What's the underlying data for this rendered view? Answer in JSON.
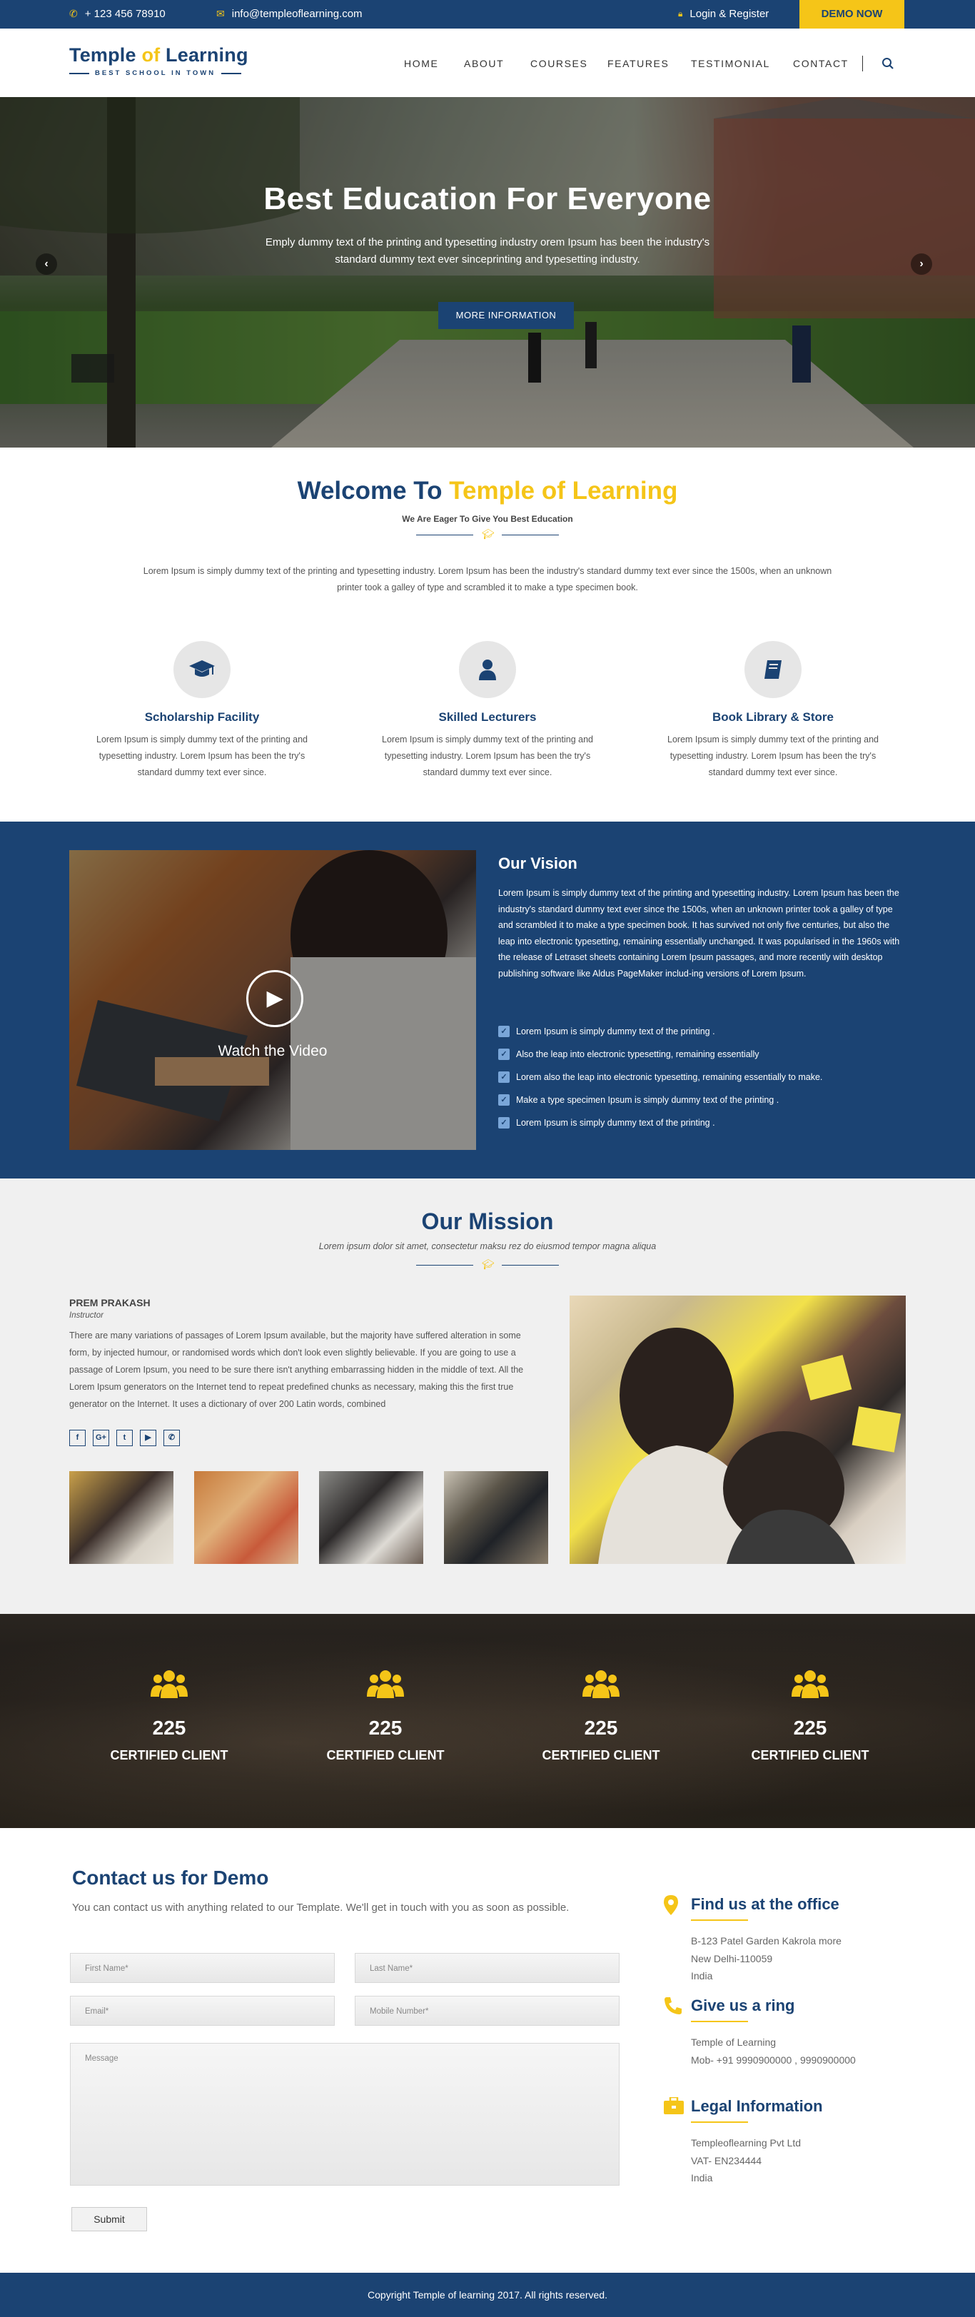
{
  "topbar": {
    "phone": "+ 123 456 78910",
    "email": "info@templeoflearning.com",
    "login": "Login & Register",
    "demo": "DEMO NOW"
  },
  "logo": {
    "pre": "Temple ",
    "of": "of",
    "post": " Learning",
    "tagline": "BEST SCHOOL IN TOWN"
  },
  "nav": [
    "HOME",
    "ABOUT",
    "COURSES",
    "FEATURES",
    "TESTIMONIAL",
    "CONTACT"
  ],
  "hero": {
    "title": "Best Education For Everyone",
    "text": "Emply dummy text of the printing and typesetting industry orem Ipsum has been the industry's standard dummy text ever sinceprinting and typesetting industry.",
    "button": "MORE INFORMATION",
    "prev": "‹",
    "next": "›"
  },
  "welcome": {
    "title_pre": "Welcome To ",
    "title_highlight": "Temple of Learning",
    "subtitle": "We Are Eager To Give You Best Education",
    "intro": "Lorem Ipsum is simply dummy text of the printing and typesetting industry. Lorem Ipsum has been the industry's standard dummy text ever since the 1500s, when an unknown printer took a galley of type and scrambled it to make a type specimen book."
  },
  "features": [
    {
      "icon": "graduation-cap-icon",
      "title": "Scholarship Facility",
      "text": "Lorem Ipsum is simply dummy text of the printing and typesetting industry. Lorem Ipsum has been the try's standard dummy text ever since."
    },
    {
      "icon": "user-icon",
      "title": "Skilled Lecturers",
      "text": "Lorem Ipsum is simply dummy text of the printing and typesetting industry. Lorem Ipsum has been the try's standard dummy text ever since."
    },
    {
      "icon": "book-icon",
      "title": "Book Library & Store",
      "text": "Lorem Ipsum is simply dummy text of the printing and typesetting industry. Lorem Ipsum has been the try's standard dummy text ever since."
    }
  ],
  "vision": {
    "video_label": "Watch the Video",
    "title": "Our Vision",
    "text": "Lorem Ipsum is simply dummy text of the printing and typesetting industry. Lorem Ipsum has been the industry's standard dummy text ever since the 1500s, when an unknown printer took a galley of type and scrambled it to make a type specimen book. It has survived not only five centuries, but also the leap into electronic typesetting, remaining essentially unchanged. It was popularised in the 1960s with the release of Letraset sheets containing Lorem Ipsum passages, and more recently with desktop publishing software like Aldus PageMaker includ-ing versions of Lorem Ipsum.",
    "checks": [
      "Lorem Ipsum is simply dummy text of the printing .",
      "Also the leap into electronic typesetting, remaining essentially",
      "Lorem also the leap into electronic typesetting, remaining essentially  to make.",
      "Make a type specimen Ipsum is simply dummy text of the printing .",
      "Lorem Ipsum is simply dummy text of the printing ."
    ]
  },
  "mission": {
    "title": "Our Mission",
    "tagline": "Lorem ipsum dolor sit amet, consectetur maksu rez do eiusmod tempor magna aliqua",
    "name": "PREM PRAKASH",
    "role": "Instructor",
    "text": "There are many variations of passages of Lorem Ipsum available, but the majority have suffered alteration in some form, by injected humour, or randomised words which don't look even slightly believable. If you are going to use a passage of Lorem Ipsum, you need to be sure there isn't anything embarrassing hidden in the middle of text. All the Lorem Ipsum generators on the Internet tend to repeat predefined chunks as necessary, making this the first true generator on the Internet. It uses a dictionary of over 200 Latin words, combined",
    "socials": [
      {
        "icon": "facebook-icon",
        "glyph": "f"
      },
      {
        "icon": "google-plus-icon",
        "glyph": "G+"
      },
      {
        "icon": "twitter-icon",
        "glyph": "t"
      },
      {
        "icon": "youtube-icon",
        "glyph": "▶"
      },
      {
        "icon": "whatsapp-icon",
        "glyph": "✆"
      }
    ]
  },
  "counters": [
    {
      "number": "225",
      "label": "CERTIFIED CLIENT"
    },
    {
      "number": "225",
      "label": "CERTIFIED CLIENT"
    },
    {
      "number": "225",
      "label": "CERTIFIED CLIENT"
    },
    {
      "number": "225",
      "label": "CERTIFIED CLIENT"
    }
  ],
  "contact": {
    "title": "Contact us for Demo",
    "text": "You can contact us with anything related to our Template. We'll get in touch with you as soon as possible.",
    "first_name": "First Name*",
    "last_name": "Last Name*",
    "email": "Email*",
    "mobile": "Mobile Number*",
    "message": "Message",
    "submit": "Submit"
  },
  "office": {
    "title": "Find us at the office",
    "lines": [
      "B-123 Patel Garden Kakrola more",
      "New Delhi-110059",
      "India"
    ]
  },
  "ring": {
    "title": "Give us a ring",
    "lines": [
      "Temple of Learning",
      "Mob- +91 9990900000 , 9990900000"
    ]
  },
  "legal": {
    "title": "Legal Information",
    "lines": [
      "Templeoflearning Pvt Ltd",
      "VAT- EN234444",
      "India"
    ]
  },
  "footer": {
    "copyright": "Copyright  Temple of learning  2017. All rights reserved."
  },
  "colors": {
    "navy": "#1b4373",
    "yellow": "#f5c518"
  }
}
